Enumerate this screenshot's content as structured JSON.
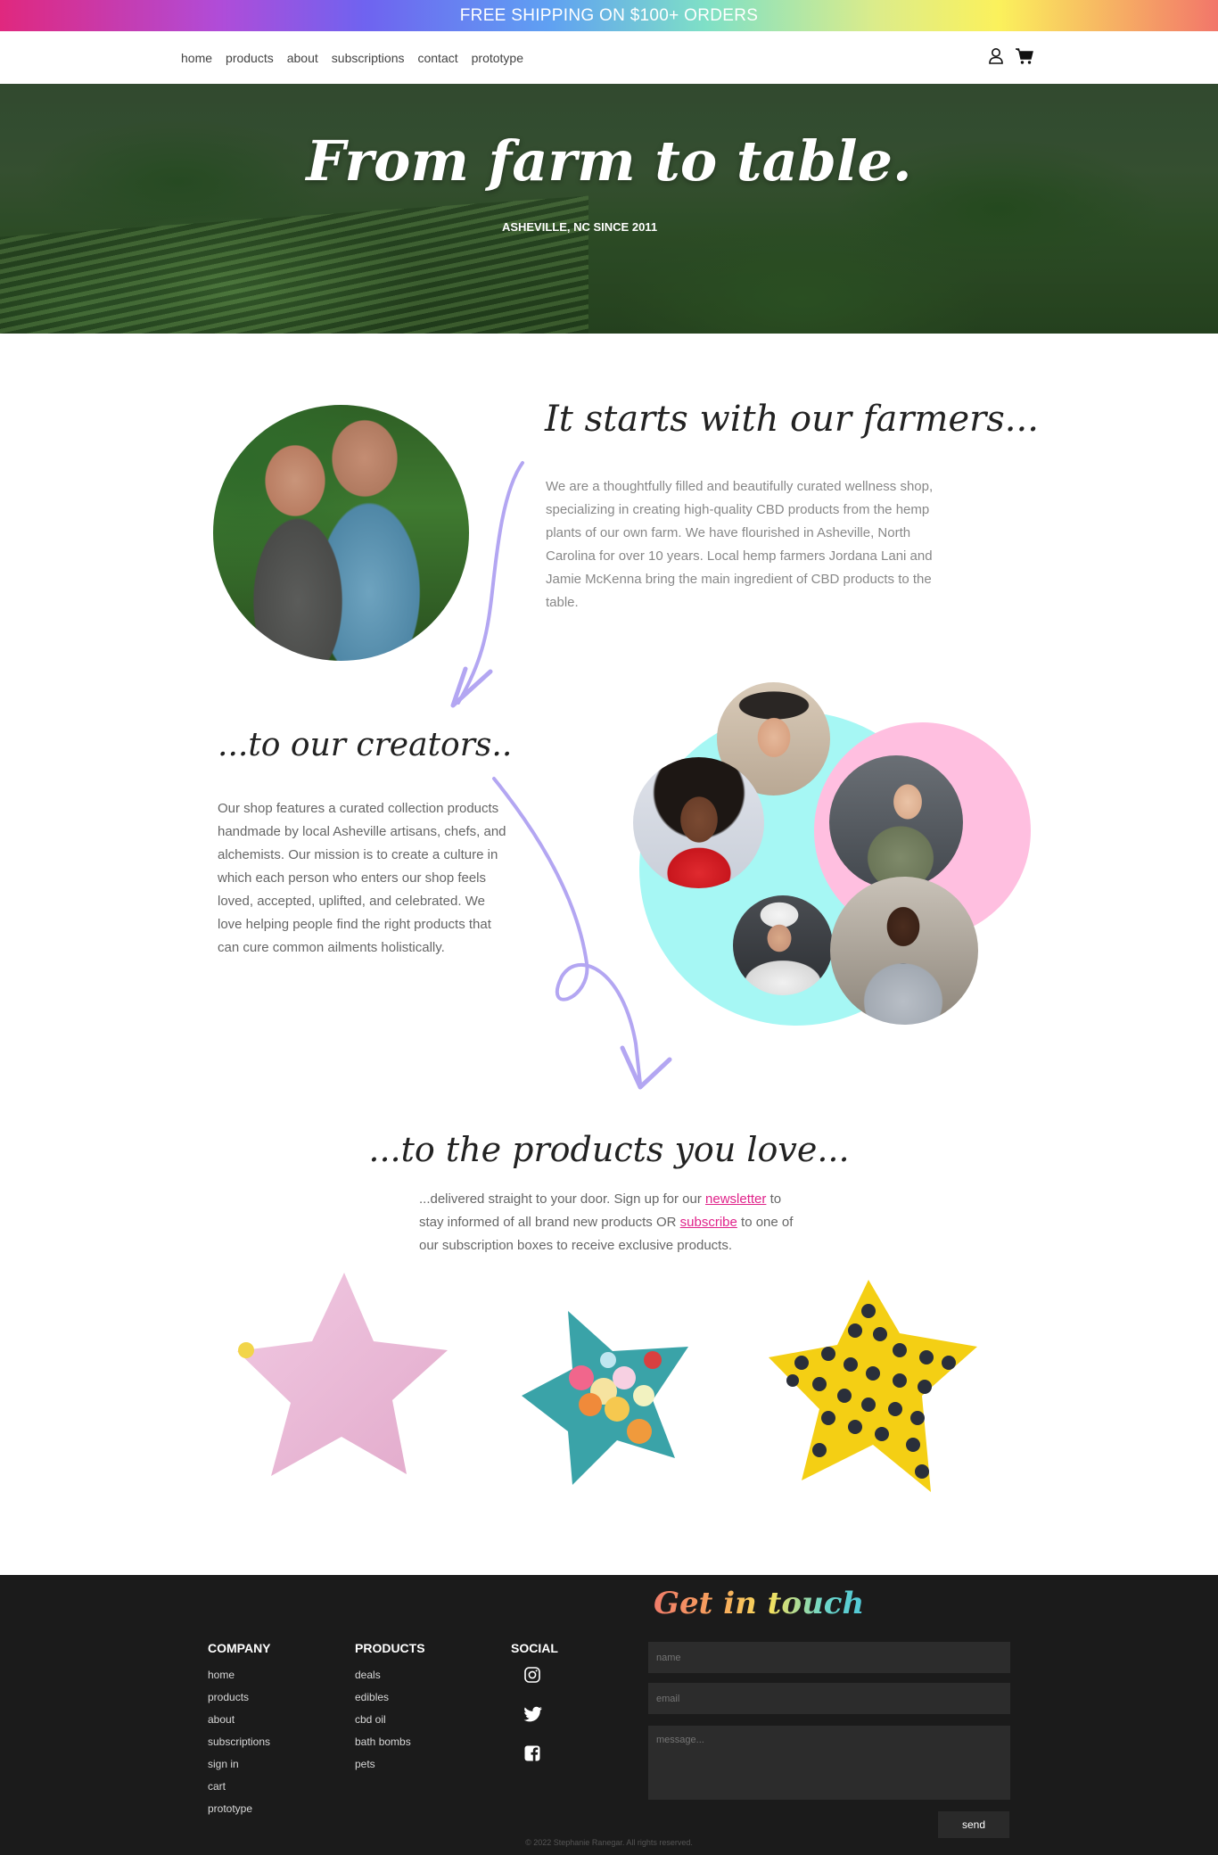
{
  "promo": {
    "text": "FREE SHIPPING ON $100+ ORDERS"
  },
  "nav": {
    "links": [
      "home",
      "products",
      "about",
      "subscriptions",
      "contact",
      "prototype"
    ],
    "icons": [
      "user-icon",
      "cart-icon"
    ]
  },
  "hero": {
    "title": "From farm to table.",
    "subtitle": "ASHEVILLE, NC SINCE 2011"
  },
  "farmers": {
    "title": "It starts with our farmers...",
    "text": "We are a thoughtfully filled and beautifully curated wellness shop, specializing in creating high-quality CBD products from the hemp plants of our own farm. We have flourished in Asheville, North Carolina for over 10 years. Local hemp farmers Jordana Lani and Jamie McKenna bring the main ingredient of CBD products to the table."
  },
  "creators": {
    "title": "...to our creators..",
    "text": "Our shop features a curated collection products handmade by local Asheville artisans, chefs, and alchemists. Our mission is to create a culture in which each person who enters our shop feels loved, accepted, uplifted, and celebrated. We love helping people find the right products that can cure common ailments holistically."
  },
  "products": {
    "title": "...to the products you love...",
    "text_before": "...delivered straight to your door. Sign up for our",
    "newsletter_link": "newsletter",
    "text_middle": "to stay informed of all brand new products OR",
    "subscribe_link": "subscribe",
    "text_after": "to one of our subscription boxes to receive exclusive products."
  },
  "colors": {
    "accent_pink": "#e0238a",
    "arrow_purple": "#b3a6f2",
    "blob_cyan": "#a6f7f4",
    "blob_pink": "#ffbfe0",
    "footer_bg": "#1b1b1b"
  },
  "footer": {
    "company": {
      "heading": "COMPANY",
      "links": [
        "home",
        "products",
        "about",
        "subscriptions",
        "sign in",
        "cart",
        "prototype"
      ]
    },
    "products": {
      "heading": "PRODUCTS",
      "links": [
        "deals",
        "edibles",
        "cbd oil",
        "bath bombs",
        "pets"
      ]
    },
    "social": {
      "heading": "SOCIAL",
      "icons": [
        "instagram-icon",
        "twitter-icon",
        "facebook-icon"
      ]
    },
    "contact": {
      "title": "Get in touch",
      "name_placeholder": "name",
      "email_placeholder": "email",
      "message_placeholder": "message...",
      "send_label": "send"
    },
    "copyright": "© 2022 Stephanie Ranegar. All rights reserved."
  }
}
